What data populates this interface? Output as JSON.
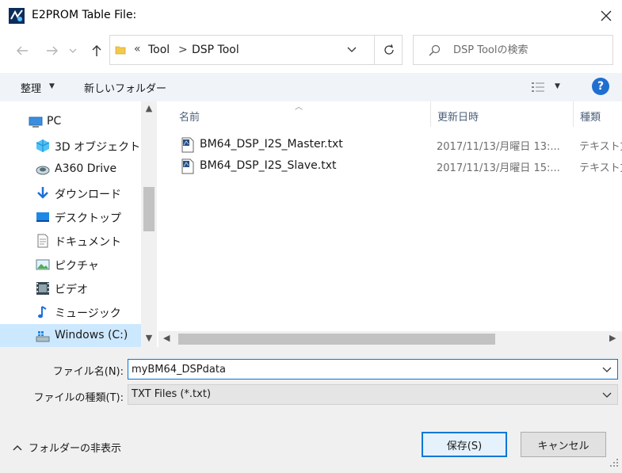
{
  "window": {
    "title": "E2PROM Table File:",
    "close_icon": "close-icon"
  },
  "nav": {
    "back_icon": "back-arrow-icon",
    "forward_icon": "forward-arrow-icon",
    "recent_icon": "chevron-down-icon",
    "up_icon": "up-arrow-icon"
  },
  "address": {
    "overflow": "«",
    "crumbs": [
      "Tool",
      "DSP Tool"
    ],
    "separator": ">"
  },
  "search": {
    "placeholder": "DSP Toolの検索"
  },
  "toolbar": {
    "organize_label": "整理",
    "new_folder_label": "新しいフォルダー",
    "help_label": "?"
  },
  "sidebar": {
    "items": [
      {
        "label": "PC",
        "icon": "pc-icon"
      },
      {
        "label": "3D オブジェクト",
        "icon": "3d-objects-icon"
      },
      {
        "label": "A360 Drive",
        "icon": "cloud-drive-icon"
      },
      {
        "label": "ダウンロード",
        "icon": "download-icon"
      },
      {
        "label": "デスクトップ",
        "icon": "desktop-icon"
      },
      {
        "label": "ドキュメント",
        "icon": "document-icon"
      },
      {
        "label": "ピクチャ",
        "icon": "pictures-icon"
      },
      {
        "label": "ビデオ",
        "icon": "video-icon"
      },
      {
        "label": "ミュージック",
        "icon": "music-icon"
      },
      {
        "label": "Windows (C:)",
        "icon": "drive-icon",
        "selected": true
      }
    ]
  },
  "filelist": {
    "columns": [
      "名前",
      "更新日時",
      "種類"
    ],
    "files": [
      {
        "name": "BM64_DSP_I2S_Master.txt",
        "date": "2017/11/13/月曜日 13:...",
        "type": "テキスト文"
      },
      {
        "name": "BM64_DSP_I2S_Slave.txt",
        "date": "2017/11/13/月曜日 15:...",
        "type": "テキスト文"
      }
    ]
  },
  "bottom": {
    "filename_label": "ファイル名(N):",
    "filename_value": "myBM64_DSPdata",
    "filetype_label": "ファイルの種類(T):",
    "filetype_value": "TXT Files (*.txt)",
    "hide_folders_label": "フォルダーの非表示",
    "save_label": "保存(S)",
    "cancel_label": "キャンセル"
  },
  "colors": {
    "accent": "#0078d7",
    "selection": "#cce8ff",
    "toolbar_bg": "#f0f4f9",
    "footer_bg": "#f0f0f0"
  }
}
